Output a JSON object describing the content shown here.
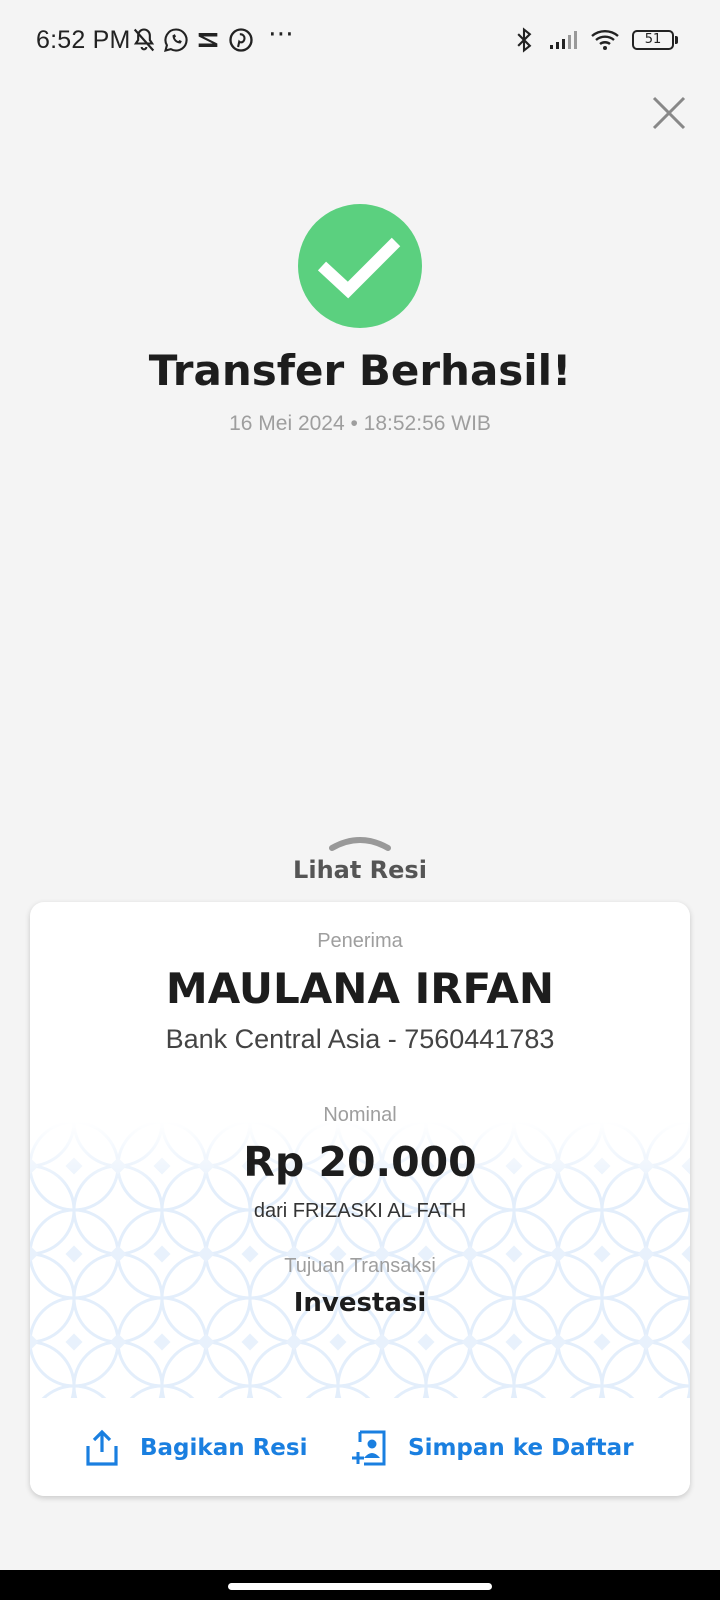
{
  "status_bar": {
    "time": "6:52 PM",
    "battery": "51",
    "icons": [
      "mute-bell-icon",
      "whatsapp-icon",
      "capcut-icon",
      "pinterest-icon",
      "more-dots-icon",
      "bluetooth-icon",
      "signal-icon",
      "wifi-icon",
      "battery-icon"
    ]
  },
  "header": {
    "close_icon": "close-icon"
  },
  "success": {
    "title": "Transfer Berhasil!",
    "datetime": "16 Mei 2024 • 18:52:56 WIB",
    "icon": "check-circle-icon",
    "color": "#5bd07f"
  },
  "receipt_toggle": {
    "label": "Lihat Resi",
    "icon": "chevron-up-icon"
  },
  "receipt": {
    "recipient_label": "Penerima",
    "recipient_name": "MAULANA IRFAN",
    "recipient_bank": "Bank Central Asia - 7560441783",
    "amount_label": "Nominal",
    "amount": "Rp 20.000",
    "sender": "dari FRIZASKI AL FATH",
    "purpose_label": "Tujuan Transaksi",
    "purpose": "Investasi"
  },
  "actions": {
    "share_label": "Bagikan Resi",
    "share_icon": "share-icon",
    "save_label": "Simpan ke Daftar",
    "save_icon": "add-contact-icon",
    "accent": "#1a7fe0"
  }
}
